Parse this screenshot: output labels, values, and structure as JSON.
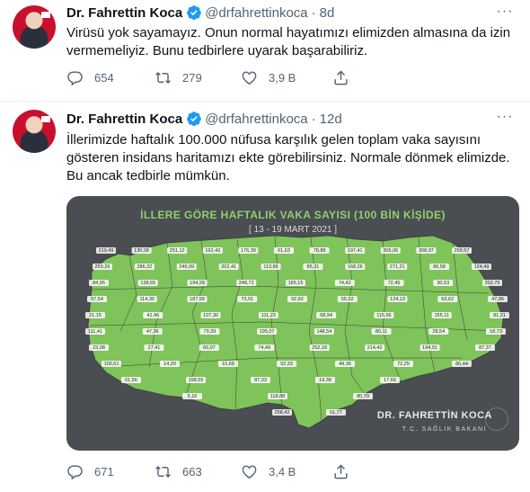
{
  "tweets": [
    {
      "name": "Dr. Fahrettin Koca",
      "handle": "@drfahrettinkoca",
      "time": "8d",
      "text": "Virüsü yok sayamayız. Onun normal hayatımızı elimizden almasına da izin vermemeliyiz. Bunu tedbirlere uyarak başarabiliriz.",
      "replies": "654",
      "retweets": "279",
      "likes": "3,9 B"
    },
    {
      "name": "Dr. Fahrettin Koca",
      "handle": "@drfahrettinkoca",
      "time": "12d",
      "text": "İllerimizde haftalık 100.000 nüfusa karşılık gelen toplam vaka sayısını gösteren insidans haritamızı ekte görebilirsiniz. Normale dönmek elimizde. Bu ancak tedbirle mümkün.",
      "replies": "671",
      "retweets": "663",
      "likes": "3,4 B",
      "image": {
        "title": "İLLERE GÖRE HAFTALIK VAKA SAYISI (100 BİN KİŞİDE)",
        "date_range": "[ 13 - 19 MART 2021 ]",
        "signature": "DR. FAHRETTİN KOCA",
        "signature_sub": "T.C. SAĞLIK BAKANI",
        "values": [
          "219,49",
          "130,08",
          "251,12",
          "192,43",
          "176,39",
          "61,63",
          "78,88",
          "197,41",
          "305,06",
          "308,97",
          "258,57",
          "259,26",
          "286,32",
          "246,09",
          "202,41",
          "113,86",
          "85,31",
          "168,26",
          "271,21",
          "86,58",
          "124,49",
          "84,95",
          "138,65",
          "194,28",
          "248,72",
          "165,15",
          "74,42",
          "72,45",
          "30,53",
          "202,75",
          "97,54",
          "114,30",
          "187,99",
          "73,91",
          "92,82",
          "55,02",
          "124,13",
          "63,62",
          "47,96",
          "21,15",
          "41,46",
          "107,30",
          "111,23",
          "68,94",
          "115,56",
          "155,11",
          "81,21",
          "111,41",
          "47,36",
          "79,39",
          "195,07",
          "148,54",
          "80,11",
          "28,54",
          "18,73",
          "23,08",
          "27,41",
          "69,07",
          "74,49",
          "252,18",
          "214,42",
          "194,91",
          "87,37",
          "100,61",
          "14,20",
          "15,68",
          "92,33",
          "49,36",
          "72,25",
          "80,44",
          "61,56",
          "198,55",
          "87,33",
          "19,38",
          "17,66",
          "5,16",
          "118,88",
          "80,70",
          "258,42",
          "61,77"
        ]
      }
    }
  ],
  "colors": {
    "verified": "#1d9bf0",
    "map_bg": "#4a4d52",
    "map_title": "#8fd16a"
  },
  "icons": [
    "reply-icon",
    "retweet-icon",
    "like-icon",
    "share-icon",
    "verified-icon",
    "more-icon"
  ]
}
